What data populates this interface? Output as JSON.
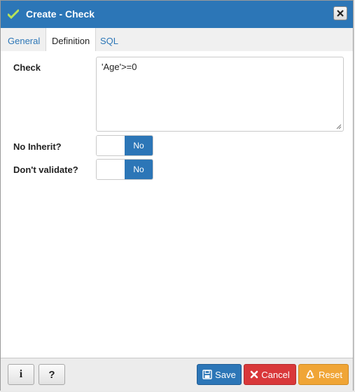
{
  "window": {
    "title": "Create - Check"
  },
  "tabs": [
    {
      "label": "General",
      "active": false
    },
    {
      "label": "Definition",
      "active": true
    },
    {
      "label": "SQL",
      "active": false
    }
  ],
  "definition": {
    "check_label": "Check",
    "check_value": "'Age'>=0",
    "no_inherit_label": "No Inherit?",
    "no_inherit_value": "No",
    "dont_validate_label": "Don't validate?",
    "dont_validate_value": "No"
  },
  "footer": {
    "info_label": "i",
    "help_label": "?",
    "save_label": "Save",
    "cancel_label": "Cancel",
    "reset_label": "Reset"
  },
  "colors": {
    "title_bar": "#2c76b7",
    "save": "#2c76b7",
    "cancel": "#d9383a",
    "reset": "#f0a536"
  }
}
